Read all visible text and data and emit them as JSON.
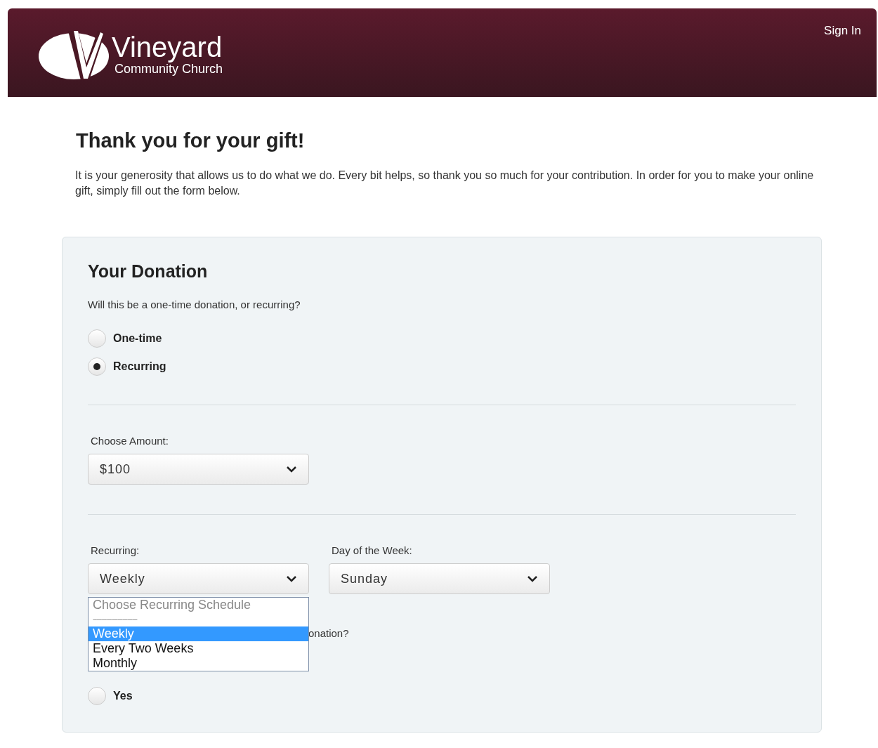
{
  "header": {
    "logo_title": "Vineyard",
    "logo_subtitle": "Community Church",
    "sign_in": "Sign In"
  },
  "heading": "Thank you for your gift!",
  "intro": "It is your generosity that allows us to do what we do. Every bit helps, so thank you so much for your contribution. In order for you to make your online gift, simply fill out the form below.",
  "donation": {
    "title": "Your Donation",
    "question": "Will this be a one-time donation, or recurring?",
    "options": [
      {
        "label": "One-time",
        "selected": false
      },
      {
        "label": "Recurring",
        "selected": true
      }
    ],
    "amount_label": "Choose Amount:",
    "amount_value": "$100",
    "recurring_label": "Recurring:",
    "recurring_value": "Weekly",
    "day_label": "Day of the Week:",
    "day_value": "Sunday",
    "recurring_menu": [
      {
        "label": "Choose Recurring Schedule",
        "kind": "hint",
        "selected": false
      },
      {
        "label": "---------------------------",
        "kind": "divider",
        "selected": false
      },
      {
        "label": "Weekly",
        "kind": "option",
        "selected": true
      },
      {
        "label": "Every Two Weeks",
        "kind": "option",
        "selected": false
      },
      {
        "label": "Monthly",
        "kind": "option",
        "selected": false
      }
    ],
    "second_question": "onation?",
    "second_options": [
      {
        "label": "Yes",
        "selected": false
      }
    ]
  }
}
